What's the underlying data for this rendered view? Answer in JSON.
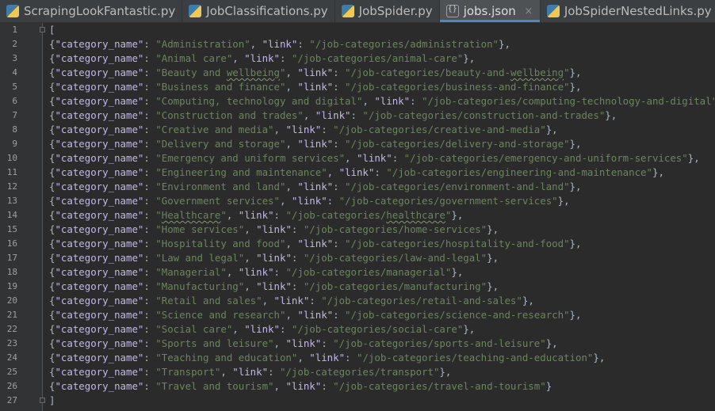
{
  "tabs": [
    {
      "label": "ScrapingLookFantastic.py",
      "icon": "python-file-icon",
      "active": false,
      "closable": false
    },
    {
      "label": "JobClassifications.py",
      "icon": "python-file-icon",
      "active": false,
      "closable": false
    },
    {
      "label": "JobSpider.py",
      "icon": "python-file-icon",
      "active": false,
      "closable": false
    },
    {
      "label": "jobs.json",
      "icon": "json-file-icon",
      "active": true,
      "closable": true
    },
    {
      "label": "JobSpiderNestedLinks.py",
      "icon": "python-file-icon",
      "active": false,
      "closable": false
    }
  ],
  "close_glyph": "×",
  "colors": {
    "key": "#c3b7ea",
    "string": "#6a8759",
    "text": "#a9b7c6",
    "accent": "#4a88c7"
  },
  "editor": {
    "open_bracket": "[",
    "close_bracket": "]",
    "key_category": "\"category_name\"",
    "key_link": "\"link\"",
    "entries": [
      {
        "name": "Administration",
        "link": "/job-categories/administration"
      },
      {
        "name": "Animal care",
        "link": "/job-categories/animal-care"
      },
      {
        "name": "Beauty and wellbeing",
        "link": "/job-categories/beauty-and-wellbeing"
      },
      {
        "name": "Business and finance",
        "link": "/job-categories/business-and-finance"
      },
      {
        "name": "Computing, technology and digital",
        "link": "/job-categories/computing-technology-and-digital"
      },
      {
        "name": "Construction and trades",
        "link": "/job-categories/construction-and-trades"
      },
      {
        "name": "Creative and media",
        "link": "/job-categories/creative-and-media"
      },
      {
        "name": "Delivery and storage",
        "link": "/job-categories/delivery-and-storage"
      },
      {
        "name": "Emergency and uniform services",
        "link": "/job-categories/emergency-and-uniform-services"
      },
      {
        "name": "Engineering and maintenance",
        "link": "/job-categories/engineering-and-maintenance"
      },
      {
        "name": "Environment and land",
        "link": "/job-categories/environment-and-land"
      },
      {
        "name": "Government services",
        "link": "/job-categories/government-services"
      },
      {
        "name": "Healthcare",
        "link": "/job-categories/healthcare"
      },
      {
        "name": "Home services",
        "link": "/job-categories/home-services"
      },
      {
        "name": "Hospitality and food",
        "link": "/job-categories/hospitality-and-food"
      },
      {
        "name": "Law and legal",
        "link": "/job-categories/law-and-legal"
      },
      {
        "name": "Managerial",
        "link": "/job-categories/managerial"
      },
      {
        "name": "Manufacturing",
        "link": "/job-categories/manufacturing"
      },
      {
        "name": "Retail and sales",
        "link": "/job-categories/retail-and-sales"
      },
      {
        "name": "Science and research",
        "link": "/job-categories/science-and-research"
      },
      {
        "name": "Social care",
        "link": "/job-categories/social-care"
      },
      {
        "name": "Sports and leisure",
        "link": "/job-categories/sports-and-leisure"
      },
      {
        "name": "Teaching and education",
        "link": "/job-categories/teaching-and-education"
      },
      {
        "name": "Transport",
        "link": "/job-categories/transport"
      },
      {
        "name": "Travel and tourism",
        "link": "/job-categories/travel-and-tourism"
      }
    ]
  },
  "line_numbers": [
    "1",
    "2",
    "3",
    "4",
    "5",
    "6",
    "7",
    "8",
    "9",
    "10",
    "11",
    "12",
    "13",
    "14",
    "15",
    "16",
    "17",
    "18",
    "19",
    "20",
    "21",
    "22",
    "23",
    "24",
    "25",
    "26",
    "27"
  ]
}
